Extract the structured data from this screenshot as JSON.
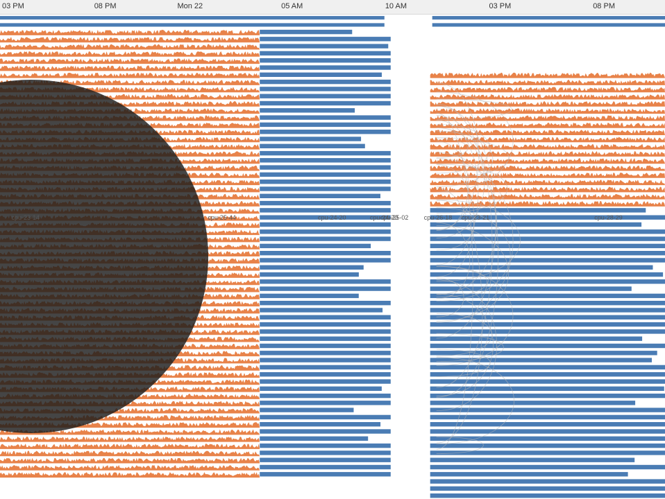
{
  "chart_data": {
    "type": "area",
    "description_note": "",
    "x_ticks": [
      {
        "label": "03 PM",
        "hour": 15
      },
      {
        "label": "08 PM",
        "hour": 20
      },
      {
        "label": "Mon 22",
        "hour": 24
      },
      {
        "label": "05 AM",
        "hour": 29
      },
      {
        "label": "10 AM",
        "hour": 34
      },
      {
        "label": "03 PM",
        "hour": 39
      },
      {
        "label": "08 PM",
        "hour": 44
      }
    ],
    "x_range_hours": [
      15,
      47
    ],
    "row_count": 68,
    "colors": {
      "idle": "#4a7cb4",
      "busy": "#e8834a",
      "links": "#b9b9b9",
      "overlay": "#1c1c1c"
    },
    "annotations": [
      {
        "text": "cpu-23-14",
        "hour": 15.55
      },
      {
        "text": "cpu-25-44",
        "hour": 25.0
      },
      {
        "text": "cpu-24-20",
        "hour": 30.3
      },
      {
        "text": "cpu-24-20",
        "hour": 32.8
      },
      {
        "text": "cpu-25-02",
        "hour": 33.3
      },
      {
        "text": "cpu-26-18",
        "hour": 35.4
      },
      {
        "text": "cpu-23-21",
        "hour": 37.2
      },
      {
        "text": "cpu-28-29",
        "hour": 43.6
      }
    ],
    "segments": [
      {
        "name": "early-busy",
        "rows": [
          2,
          64
        ],
        "start_hour": 15.0,
        "end_hour": 27.5,
        "state": "busy"
      },
      {
        "name": "night-idle",
        "rows": [
          2,
          64
        ],
        "start_hour": 27.5,
        "end_hour": 33.8,
        "state": "idle"
      },
      {
        "name": "late-busy",
        "rows": [
          8,
          26
        ],
        "start_hour": 35.7,
        "end_hour": 47.0,
        "state": "busy"
      },
      {
        "name": "late-idle",
        "rows": [
          27,
          67
        ],
        "start_hour": 35.7,
        "end_hour": 47.0,
        "state": "idle"
      }
    ]
  }
}
